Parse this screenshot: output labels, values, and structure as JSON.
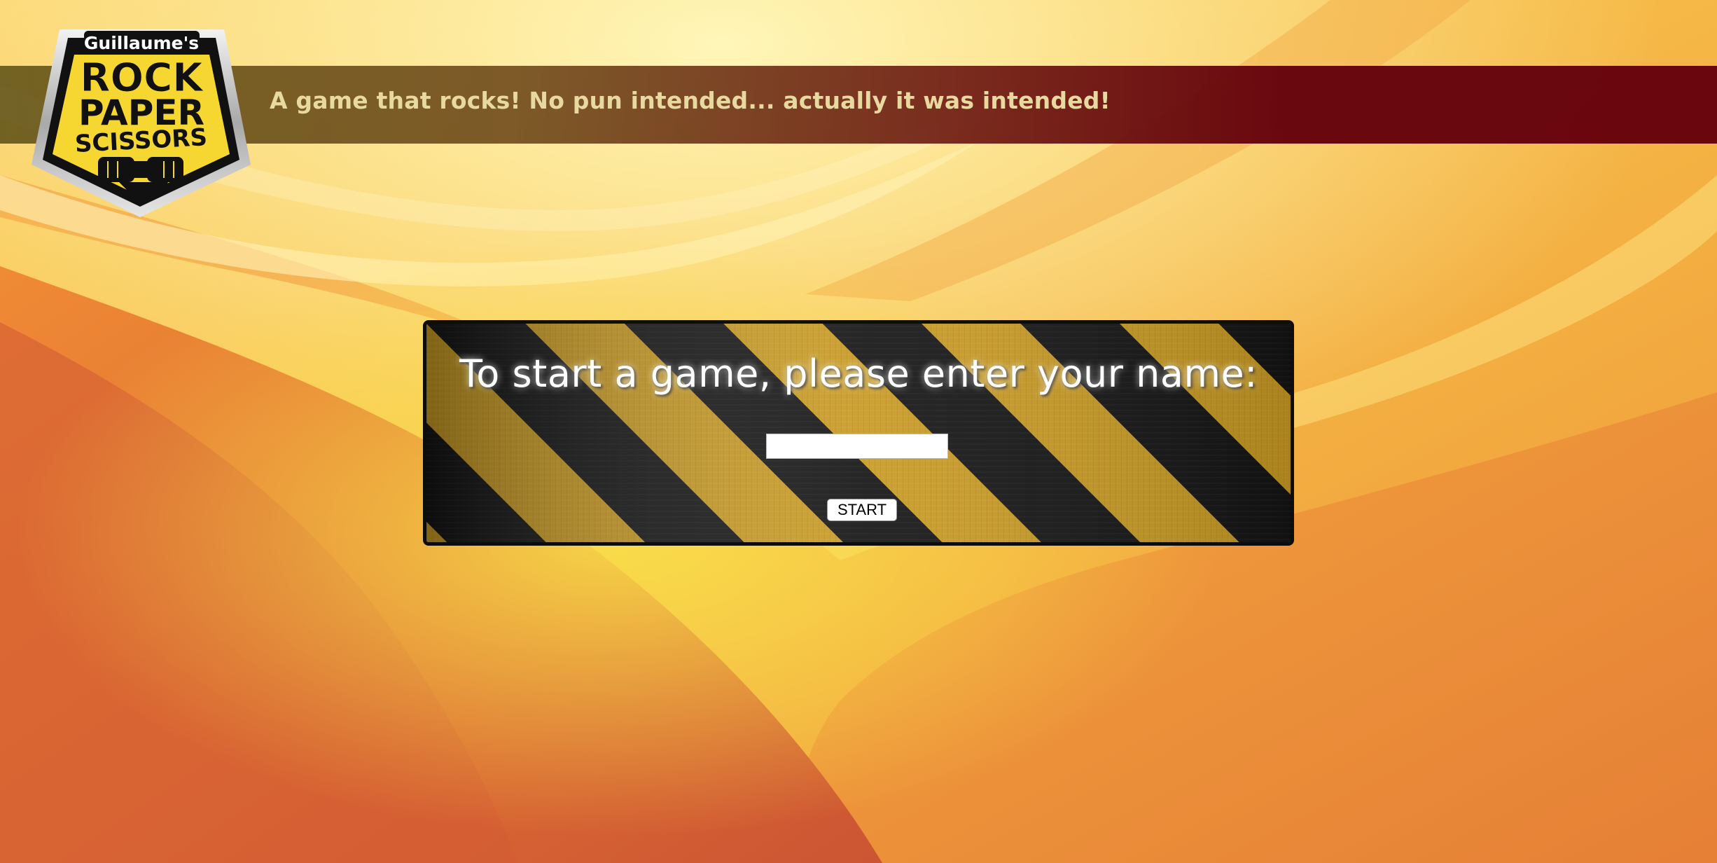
{
  "header": {
    "tagline": "A game that rocks! No pun intended... actually it was intended!",
    "logo": {
      "owner": "Guillaume's",
      "line1": "ROCK",
      "line2": "PAPER",
      "line3": "SCISSORS"
    }
  },
  "start_panel": {
    "prompt": "To start a game, please enter your name:",
    "name_input_value": "",
    "start_label": "START"
  },
  "colors": {
    "background_light": "#fde69a",
    "background_orange": "#e9852f",
    "banner": "#64000c",
    "logo_yellow": "#f6d731",
    "stripe_yellow": "#c89a24"
  },
  "icons": {
    "logo": "fists-bump-icon"
  }
}
